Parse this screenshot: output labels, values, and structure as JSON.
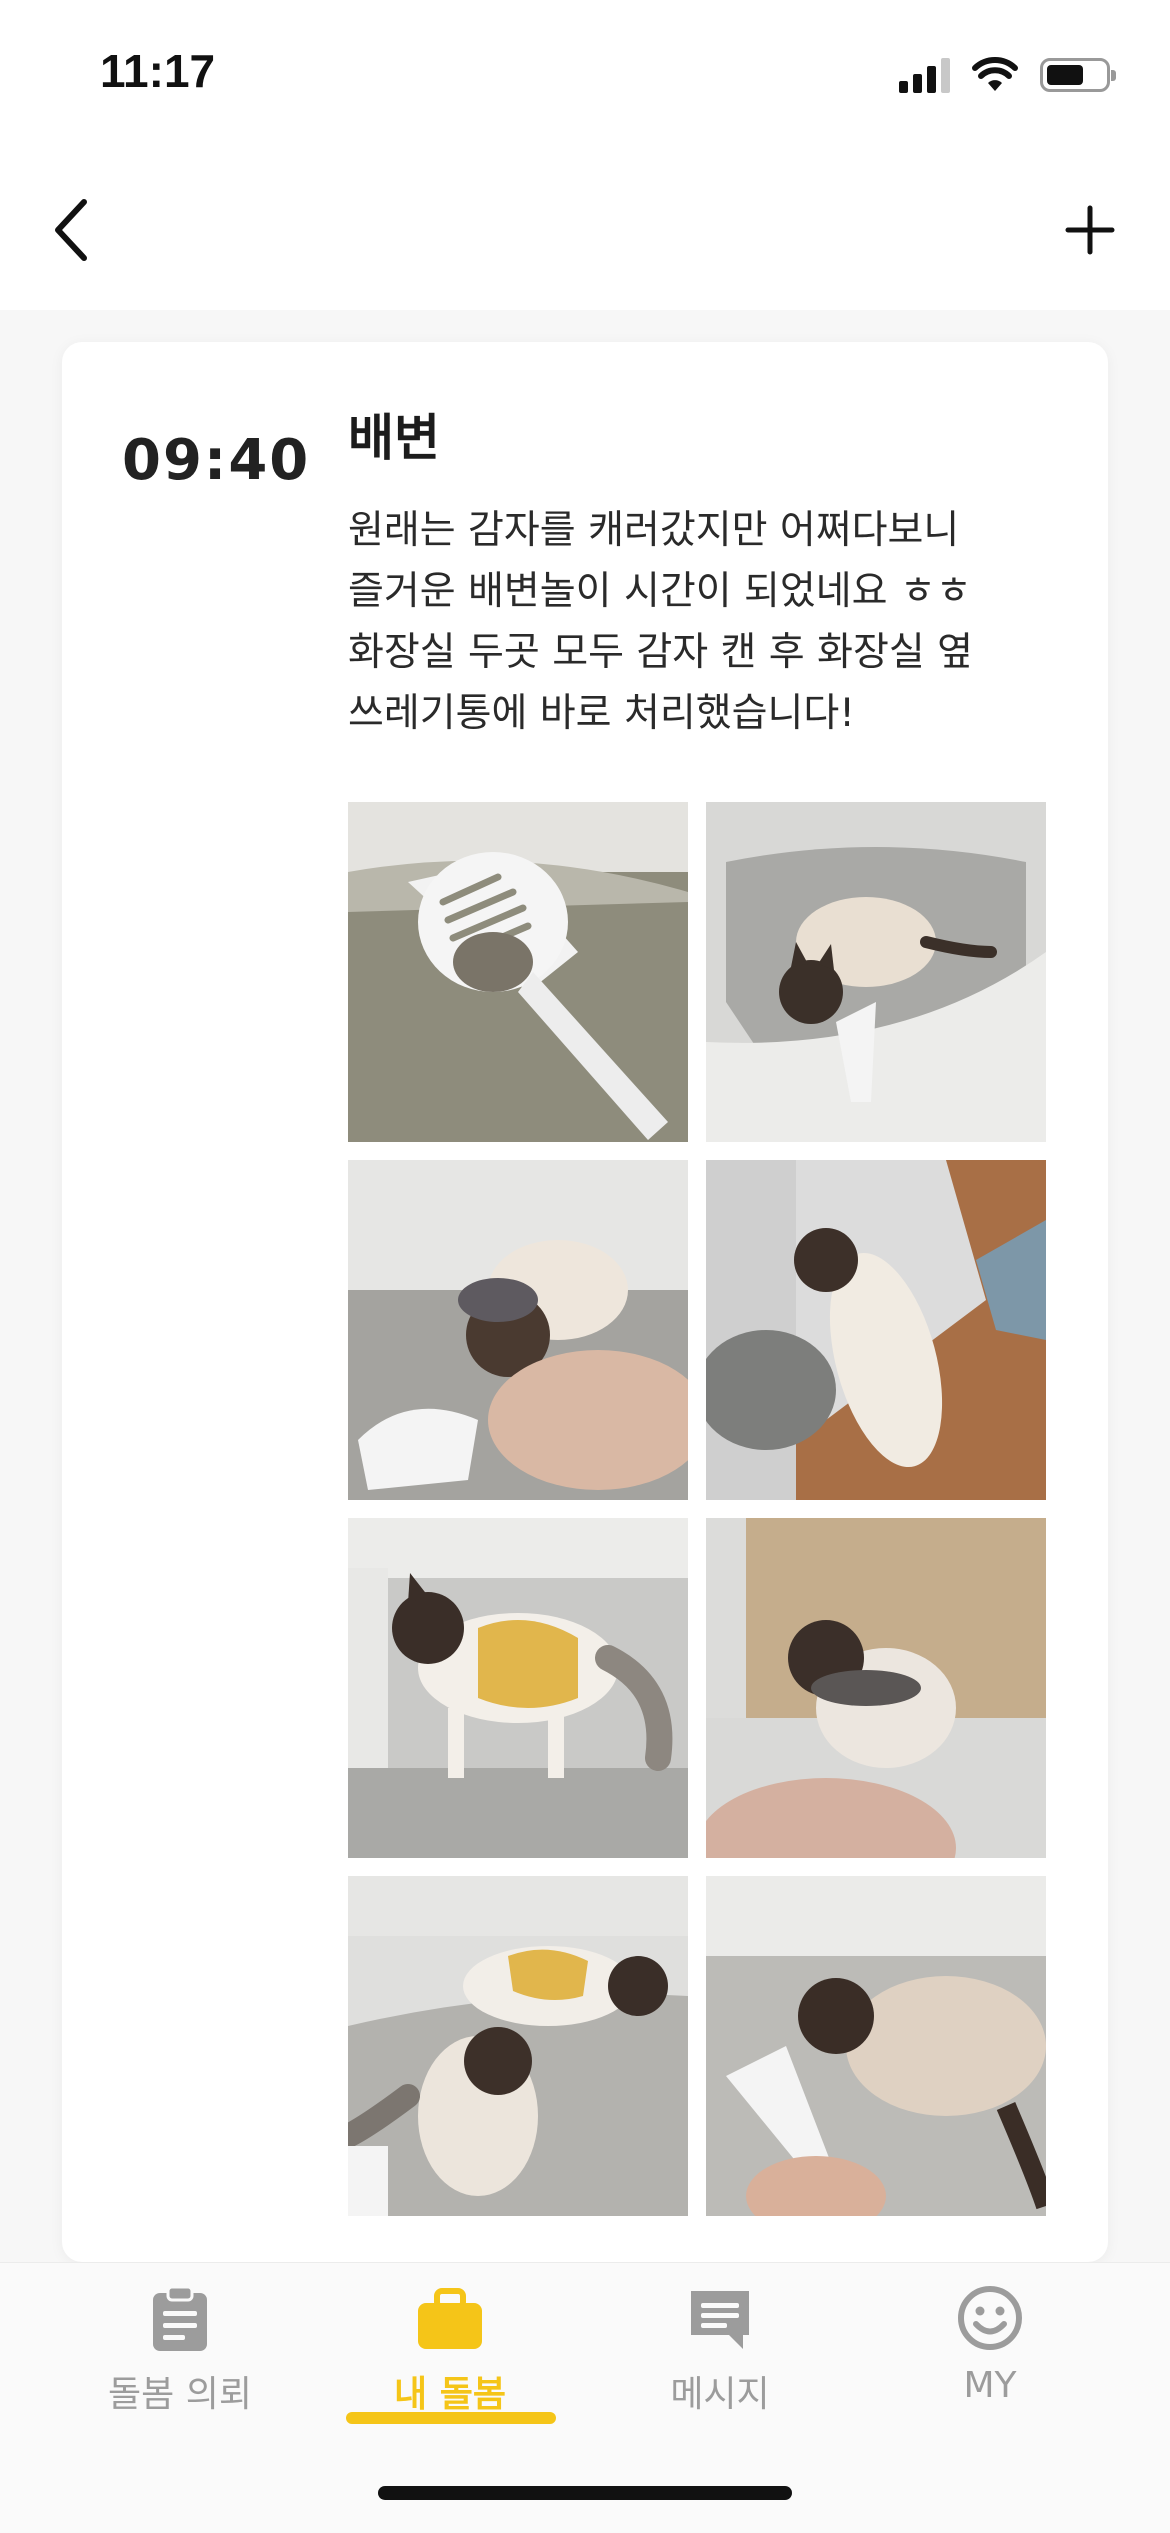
{
  "status_bar": {
    "time": "11:17",
    "battery_level": 0.6
  },
  "nav": {
    "back_icon": "chevron-left-icon",
    "add_icon": "plus-icon"
  },
  "entry": {
    "time": "09:40",
    "title": "배변",
    "body_lines": [
      "원래는 감자를 캐러갔지만 어쩌다보니",
      "즐거운 배변놀이 시간이 되었네요 ㅎㅎ",
      "화장실 두곳 모두 감자 캔 후 화장실 옆",
      "쓰레기통에 바로 처리했습니다!"
    ],
    "photos": [
      "scoop-with-litter-photo",
      "cat-in-litter-box-photo",
      "cat-digging-litter-photo",
      "cat-lying-on-floor-photo",
      "cat-in-yellow-dress-photo",
      "cat-on-litter-mat-photo",
      "two-cats-in-litter-box-photo",
      "cat-with-scoop-photo"
    ]
  },
  "tabs": [
    {
      "label": "돌봄 의뢰",
      "icon": "clipboard-icon",
      "active": false
    },
    {
      "label": "내 돌봄",
      "icon": "briefcase-icon",
      "active": true
    },
    {
      "label": "메시지",
      "icon": "message-icon",
      "active": false
    },
    {
      "label": "MY",
      "icon": "smiley-icon",
      "active": false
    }
  ],
  "colors": {
    "accent": "#f5c518",
    "inactive": "#9c9c9c",
    "background": "#f7f7f7"
  }
}
